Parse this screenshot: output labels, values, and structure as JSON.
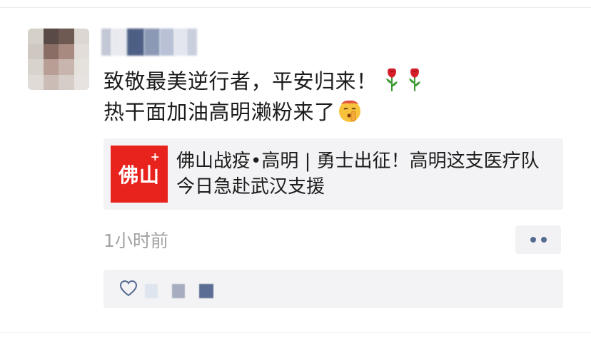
{
  "post": {
    "line1": "致敬最美逆行者，平安归来！",
    "line2": "热干面加油高明濑粉来了",
    "line1_icons": [
      "rose-icon",
      "rose-icon"
    ],
    "line2_icon": "shushing-face-icon",
    "timestamp": "1小时前"
  },
  "link_card": {
    "thumb_text": "佛山",
    "thumb_badge": "+",
    "thumb_color": "#e8221d",
    "title": "佛山战疫•高明 | 勇士出征！高明这支医疗队今日急赴武汉支援"
  },
  "actions": {
    "more_icon": "two-dots-icon",
    "accent_color": "#566b91"
  },
  "likes": {
    "icon": "heart-outline-icon"
  }
}
